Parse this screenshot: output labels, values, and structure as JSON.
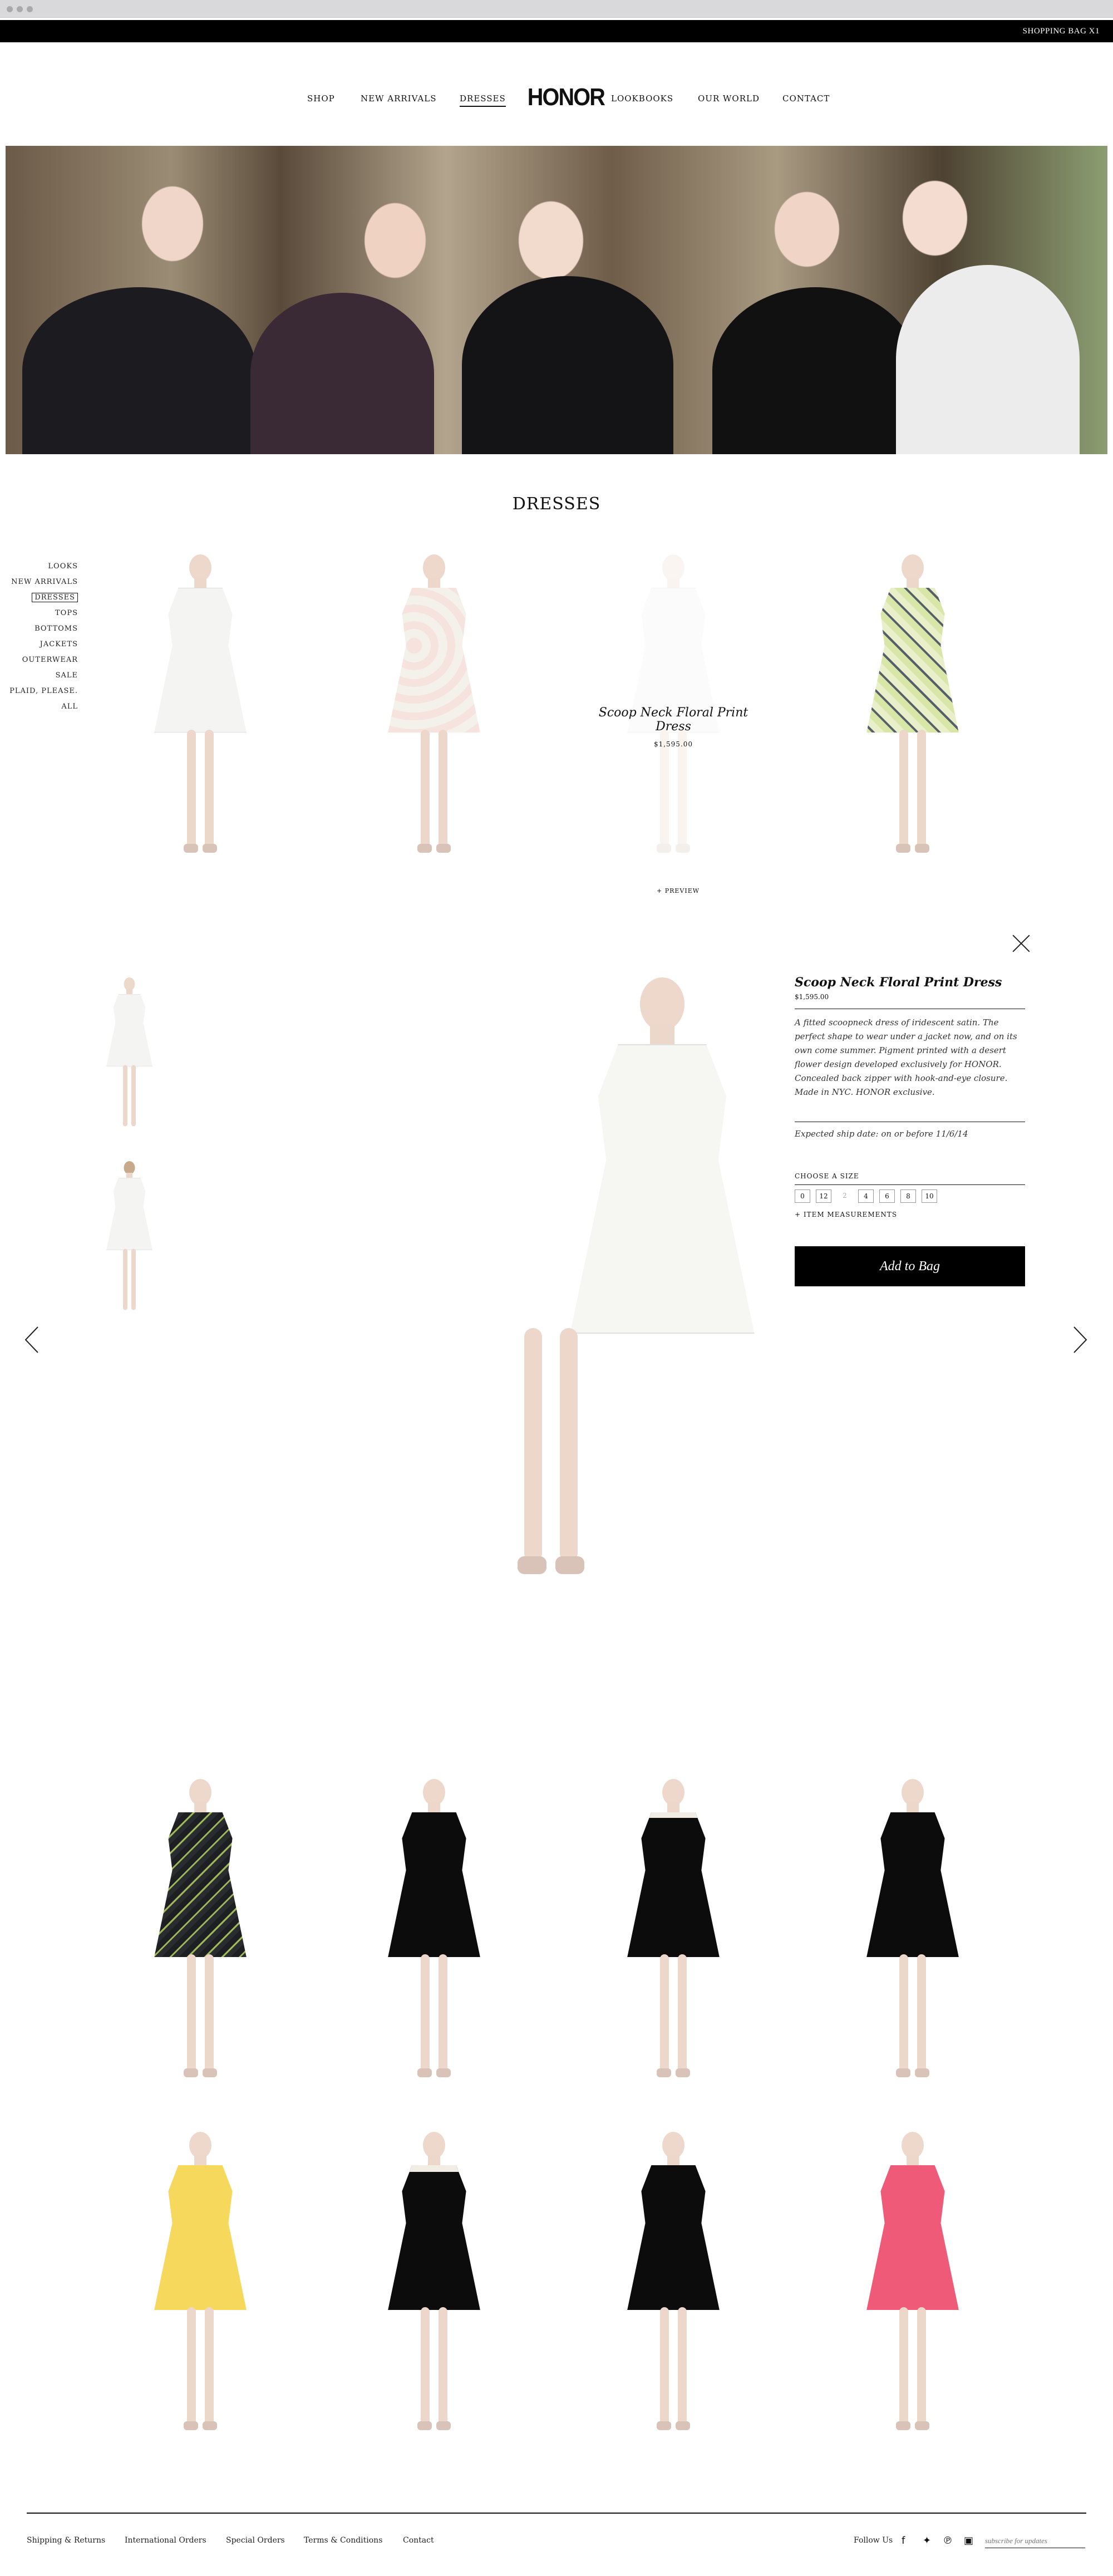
{
  "header": {
    "bag_label": "SHOPPING BAG X1",
    "logo": "HONOR"
  },
  "nav": {
    "items": [
      "SHOP",
      "NEW ARRIVALS",
      "DRESSES",
      "LOOKBOOKS",
      "OUR WORLD",
      "CONTACT"
    ]
  },
  "section": {
    "title": "DRESSES"
  },
  "sidebar": {
    "items": [
      "LOOKS",
      "NEW ARRIVALS",
      "DRESSES",
      "TOPS",
      "BOTTOMS",
      "JACKETS",
      "OUTERWEAR",
      "SALE",
      "PLAID, PLEASE.",
      "ALL"
    ]
  },
  "hover_product": {
    "name": "Scoop Neck Floral Print Dress",
    "price": "$1,595.00",
    "preview_label": "+ PREVIEW"
  },
  "detail": {
    "name": "Scoop Neck Floral Print Dress",
    "price": "$1,595.00",
    "description": "A fitted scoopneck dress of iridescent satin. The perfect shape to wear under a jacket now, and on its own come summer. Pigment printed with a desert flower design developed exclusively for HONOR. Concealed back zipper with hook-and-eye closure. Made in NYC. HONOR exclusive.",
    "ship": "Expected ship date: on or before 11/6/14",
    "choose_size": "CHOOSE A SIZE",
    "sizes": [
      "0",
      "12",
      "2",
      "4",
      "6",
      "8",
      "10"
    ],
    "measurements": "+ ITEM MEASUREMENTS",
    "add_to_bag": "Add to Bag"
  },
  "footer": {
    "links": [
      "Shipping & Returns",
      "International Orders",
      "Special Orders",
      "Terms & Conditions",
      "Contact"
    ],
    "follow": "Follow Us",
    "subscribe_placeholder": "subscribe for updates"
  },
  "colors": {
    "black": "#000000",
    "white": "#ffffff",
    "pink": "#ef5a78",
    "yellow": "#f5d45a"
  }
}
